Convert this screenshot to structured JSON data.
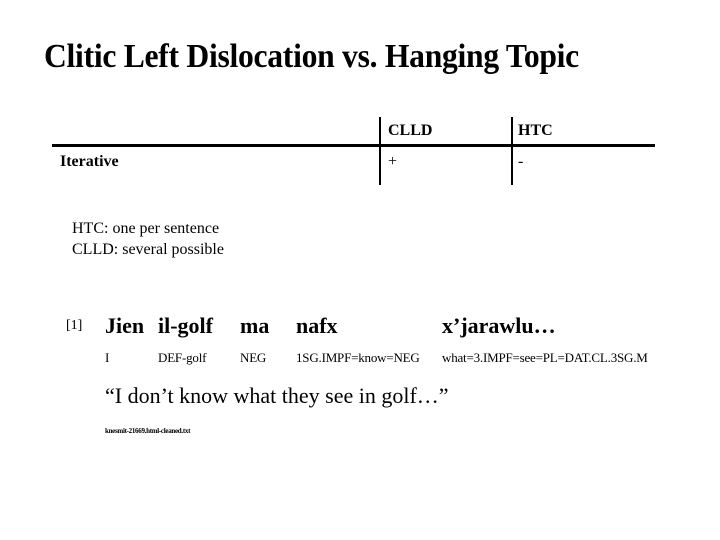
{
  "title": "Clitic Left Dislocation vs. Hanging Topic",
  "table": {
    "columns": [
      "CLLD",
      "HTC"
    ],
    "rows": [
      {
        "label": "Iterative",
        "values": [
          "+",
          "-"
        ]
      }
    ]
  },
  "notes": [
    "HTC: one per sentence",
    "CLLD: several possible"
  ],
  "example": {
    "number": "[1]",
    "words": [
      "Jien",
      "il-golf",
      "ma",
      "nafx",
      "x’jarawlu…"
    ],
    "glosses": [
      "I",
      "DEF-golf",
      "NEG",
      "1SG.IMPF=know=NEG",
      "what=3.IMPF=see=PL=DAT.CL.3SG.M"
    ],
    "translation": "“I don’t know what they see in golf…”",
    "source": "knesmit-21669.html-cleaned.txt"
  }
}
